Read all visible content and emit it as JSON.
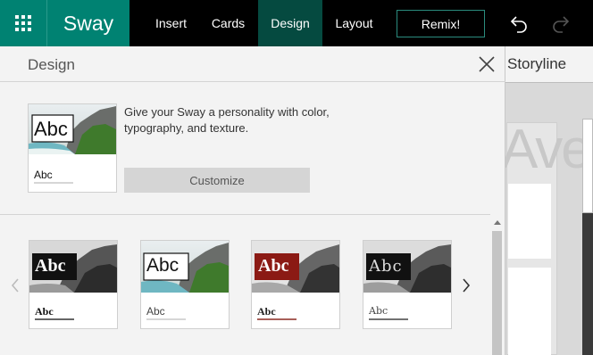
{
  "app": {
    "brand": "Sway",
    "waffle_icon": "waffle-grid-icon",
    "colors": {
      "brand_green": "#008272",
      "active_tab": "#054a40",
      "topbar": "#000000"
    }
  },
  "toolbar": {
    "tabs": [
      {
        "label": "Insert",
        "active": false
      },
      {
        "label": "Cards",
        "active": false
      },
      {
        "label": "Design",
        "active": true
      },
      {
        "label": "Layout",
        "active": false
      }
    ],
    "remix_label": "Remix!",
    "undo_icon": "undo-icon",
    "redo_icon": "redo-icon",
    "redo_enabled": false
  },
  "design_panel": {
    "title": "Design",
    "close_icon": "close-icon",
    "current_style": {
      "heading_sample": "Abc",
      "body_sample": "Abc",
      "description": "Give your Sway a personality with color, typography, and texture.",
      "customize_label": "Customize"
    },
    "styles": [
      {
        "heading_sample": "Abc",
        "body_sample": "Abc",
        "label_bg": "#111111",
        "label_fg": "#ffffff",
        "underline": "#333333",
        "image": "mono"
      },
      {
        "heading_sample": "Abc",
        "body_sample": "Abc",
        "label_bg": "#ffffff",
        "label_fg": "#000000",
        "underline": "#c8c8c8",
        "image": "color"
      },
      {
        "heading_sample": "Abc",
        "body_sample": "Abc",
        "label_bg": "#8b1a14",
        "label_fg": "#ffffff",
        "underline": "#8b2a20",
        "image": "mono"
      },
      {
        "heading_sample": "Abc",
        "body_sample": "Abc",
        "label_bg": "#111111",
        "label_fg": "#dddddd",
        "underline": "#444444",
        "image": "mono"
      }
    ],
    "prev_icon": "chevron-left-icon",
    "next_icon": "chevron-right-icon"
  },
  "storyline": {
    "label": "Storyline",
    "preview_text": "Ave"
  }
}
